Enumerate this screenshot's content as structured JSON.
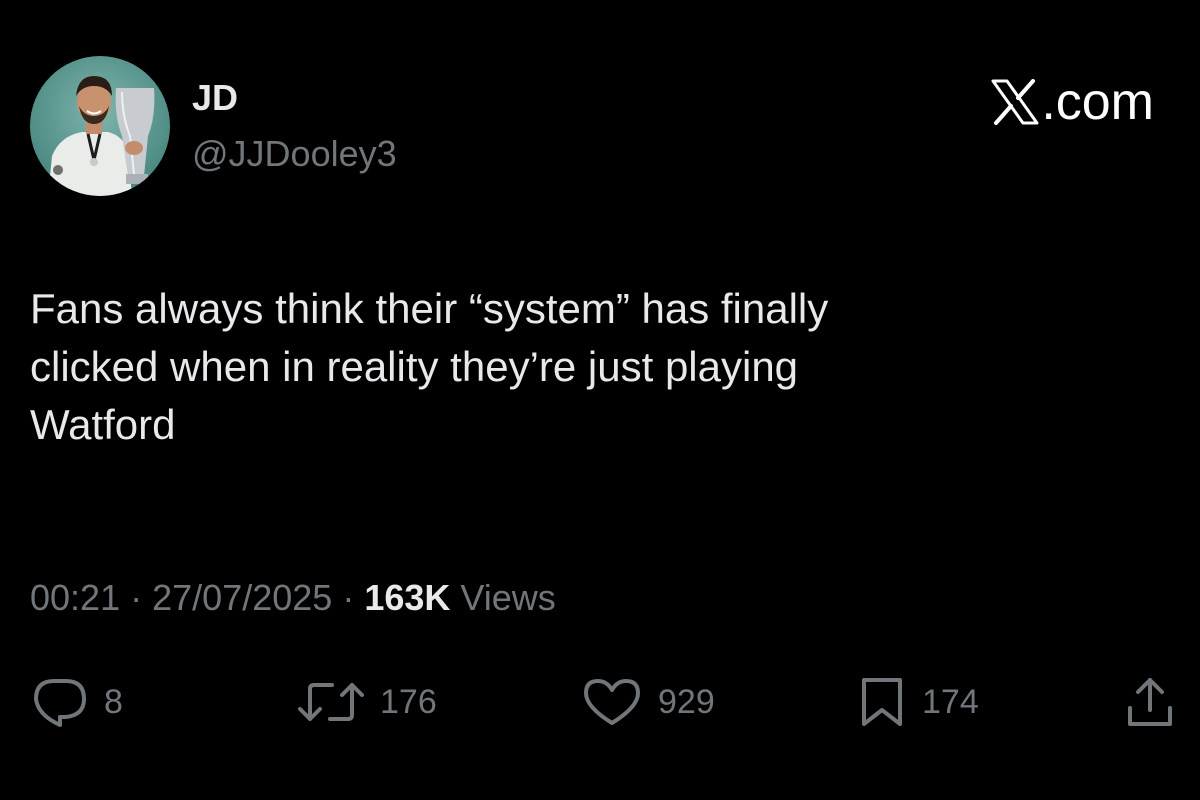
{
  "author": {
    "display_name": "JD",
    "handle": "@JJDooley3"
  },
  "brand": {
    "label": ".com",
    "icon": "x-logo-icon"
  },
  "tweet": {
    "text_lines": [
      "Fans always think their “system” has finally",
      "clicked when in reality they’re just playing",
      "Watford"
    ]
  },
  "meta": {
    "time": "00:21",
    "separator": "·",
    "date": "27/07/2025",
    "views_count": "163K",
    "views_label": "Views"
  },
  "actions": {
    "replies": {
      "icon": "reply-icon",
      "count": "8"
    },
    "reposts": {
      "icon": "repost-icon",
      "count": "176"
    },
    "likes": {
      "icon": "heart-icon",
      "count": "929"
    },
    "bookmarks": {
      "icon": "bookmark-icon",
      "count": "174"
    },
    "share": {
      "icon": "share-icon"
    }
  },
  "colors": {
    "background": "#000000",
    "primary_text": "#e7e9ea",
    "secondary_text": "#71767b"
  }
}
